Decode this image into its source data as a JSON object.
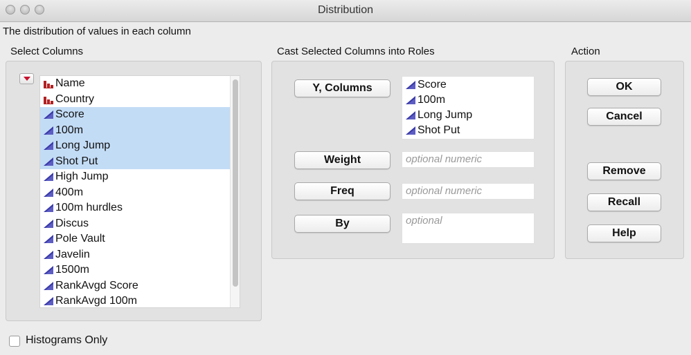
{
  "window": {
    "title": "Distribution"
  },
  "description": "The distribution of values in each column",
  "select_columns": {
    "label": "Select Columns",
    "items": [
      {
        "label": "Name",
        "icon": "nominal-bars-icon",
        "selected": false
      },
      {
        "label": "Country",
        "icon": "nominal-bars-icon",
        "selected": false
      },
      {
        "label": "Score",
        "icon": "continuous-triangle-icon",
        "selected": true
      },
      {
        "label": "100m",
        "icon": "continuous-triangle-icon",
        "selected": true
      },
      {
        "label": "Long Jump",
        "icon": "continuous-triangle-icon",
        "selected": true
      },
      {
        "label": "Shot Put",
        "icon": "continuous-triangle-icon",
        "selected": true
      },
      {
        "label": "High Jump",
        "icon": "continuous-triangle-icon",
        "selected": false
      },
      {
        "label": "400m",
        "icon": "continuous-triangle-icon",
        "selected": false
      },
      {
        "label": "100m hurdles",
        "icon": "continuous-triangle-icon",
        "selected": false
      },
      {
        "label": "Discus",
        "icon": "continuous-triangle-icon",
        "selected": false
      },
      {
        "label": "Pole Vault",
        "icon": "continuous-triangle-icon",
        "selected": false
      },
      {
        "label": "Javelin",
        "icon": "continuous-triangle-icon",
        "selected": false
      },
      {
        "label": "1500m",
        "icon": "continuous-triangle-icon",
        "selected": false
      },
      {
        "label": "RankAvgd Score",
        "icon": "continuous-triangle-icon",
        "selected": false
      },
      {
        "label": "RankAvgd 100m",
        "icon": "continuous-triangle-icon",
        "selected": false
      }
    ]
  },
  "cast_roles": {
    "label": "Cast Selected Columns into Roles",
    "y_columns": {
      "button": "Y, Columns",
      "items": [
        "Score",
        "100m",
        "Long Jump",
        "Shot Put"
      ]
    },
    "weight": {
      "button": "Weight",
      "placeholder": "optional numeric"
    },
    "freq": {
      "button": "Freq",
      "placeholder": "optional numeric"
    },
    "by": {
      "button": "By",
      "placeholder": "optional"
    }
  },
  "action": {
    "label": "Action",
    "ok": "OK",
    "cancel": "Cancel",
    "remove": "Remove",
    "recall": "Recall",
    "help": "Help"
  },
  "histograms_only": {
    "label": "Histograms Only",
    "checked": false
  },
  "colors": {
    "selection": "#c3dcf6",
    "continuous_icon": "#3a3aa8",
    "nominal_icon": "#b22222",
    "dropdown_arrow": "#c8102e"
  }
}
